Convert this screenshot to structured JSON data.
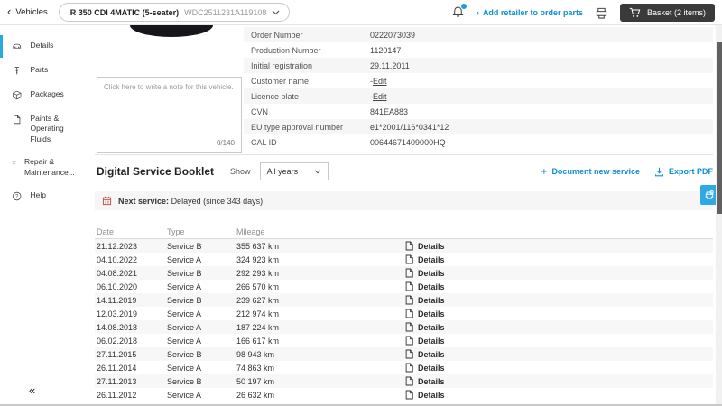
{
  "icons": {
    "back_chevron": "‹",
    "forward_chevron": "›",
    "collapse": "«",
    "plus": "+"
  },
  "colors": {
    "accent_link": "#0f90d0",
    "active_indicator": "#29a9e0",
    "fab_background": "#2fa9e1",
    "alert_icon_red": "#c0453e",
    "basket_button": "#3a3a3a"
  },
  "topbar": {
    "back_label": "Vehicles",
    "vehicle_selector": {
      "model": "R 350 CDI 4MATIC (5-seater)",
      "vin": "WDC2511231A119108"
    },
    "add_retailer_label": "Add retailer to order parts",
    "basket_label": "Basket (2 items)"
  },
  "sidebar": {
    "items": [
      {
        "label": "Details"
      },
      {
        "label": "Parts"
      },
      {
        "label": "Packages"
      },
      {
        "label": "Paints & Operating Fluids"
      },
      {
        "label": "Repair & Maintenance..."
      },
      {
        "label": "Help"
      }
    ]
  },
  "note": {
    "placeholder": "Click here to write a note for this vehicle.",
    "counter": "0/140"
  },
  "vehicle_info": {
    "rows": [
      {
        "label": "Order Number",
        "value": "0222073039"
      },
      {
        "label": "Production Number",
        "value": "1120147"
      },
      {
        "label": "Initial registration",
        "value": "29.11.2011"
      },
      {
        "label": "Customer name",
        "value": "-",
        "edit": "Edit"
      },
      {
        "label": "Licence plate",
        "value": "-",
        "edit": "Edit"
      },
      {
        "label": "CVN",
        "value": "841EA883"
      },
      {
        "label": "EU type approval number",
        "value": "e1*2001/116*0341*12"
      },
      {
        "label": "CAL ID",
        "value": "00644671409000HQ"
      }
    ]
  },
  "service_booklet": {
    "title": "Digital Service Booklet",
    "show_label": "Show",
    "filter_value": "All years",
    "document_new_service_label": "Document new service",
    "export_pdf_label": "Export PDF",
    "alert": {
      "bold": "Next service:",
      "text": "Delayed (since 343 days)"
    },
    "table": {
      "headers": [
        "Date",
        "Type",
        "Mileage"
      ],
      "details_label": "Details",
      "rows": [
        {
          "date": "21.12.2023",
          "type": "Service B",
          "mileage": "355 637 km"
        },
        {
          "date": "04.10.2022",
          "type": "Service A",
          "mileage": "324 923 km"
        },
        {
          "date": "04.08.2021",
          "type": "Service B",
          "mileage": "292 293 km"
        },
        {
          "date": "06.10.2020",
          "type": "Service A",
          "mileage": "266 570 km"
        },
        {
          "date": "14.11.2019",
          "type": "Service B",
          "mileage": "239 627 km"
        },
        {
          "date": "12.03.2019",
          "type": "Service A",
          "mileage": "212 974 km"
        },
        {
          "date": "14.08.2018",
          "type": "Service A",
          "mileage": "187 224 km"
        },
        {
          "date": "06.02.2018",
          "type": "Service A",
          "mileage": "166 617 km"
        },
        {
          "date": "27.11.2015",
          "type": "Service B",
          "mileage": "98 943 km"
        },
        {
          "date": "26.11.2014",
          "type": "Service A",
          "mileage": "74 863 km"
        },
        {
          "date": "27.11.2013",
          "type": "Service B",
          "mileage": "50 197 km"
        },
        {
          "date": "26.11.2012",
          "type": "Service A",
          "mileage": "26 632 km"
        }
      ]
    }
  }
}
